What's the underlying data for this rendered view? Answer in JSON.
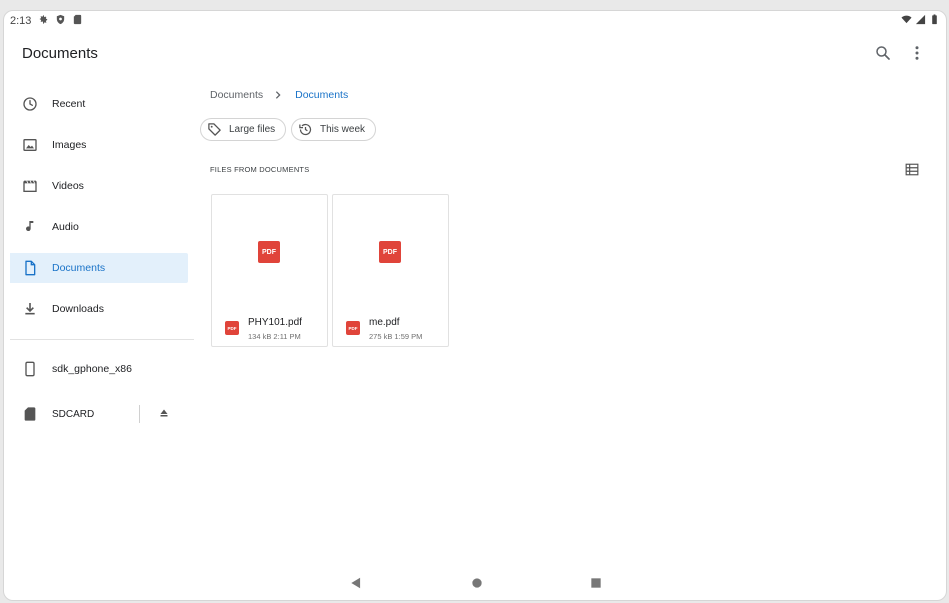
{
  "status": {
    "time": "2:13"
  },
  "appbar": {
    "title": "Documents"
  },
  "sidebar": {
    "items": [
      {
        "label": "Recent",
        "icon": "clock-icon"
      },
      {
        "label": "Images",
        "icon": "image-icon"
      },
      {
        "label": "Videos",
        "icon": "video-icon"
      },
      {
        "label": "Audio",
        "icon": "music-note-icon"
      },
      {
        "label": "Documents",
        "icon": "document-icon",
        "active": true
      },
      {
        "label": "Downloads",
        "icon": "download-icon"
      }
    ],
    "devices": [
      {
        "label": "sdk_gphone_x86",
        "icon": "phone-icon"
      },
      {
        "label": "SDCARD",
        "icon": "sd-card-icon"
      }
    ]
  },
  "breadcrumb": {
    "root": "Documents",
    "current": "Documents"
  },
  "chips": [
    {
      "label": "Large files",
      "icon": "tag-icon"
    },
    {
      "label": "This week",
      "icon": "history-icon"
    }
  ],
  "section": {
    "header": "FILES FROM DOCUMENTS"
  },
  "files": [
    {
      "name": "PHY101.pdf",
      "meta": "134 kB  2:11 PM",
      "thumb": "PDF"
    },
    {
      "name": "me.pdf",
      "meta": "275 kB  1:59 PM",
      "thumb": "PDF"
    }
  ],
  "colors": {
    "accent": "#1a73c8",
    "active_bg": "#e3f0fb",
    "pdf_red": "#e0443a"
  }
}
